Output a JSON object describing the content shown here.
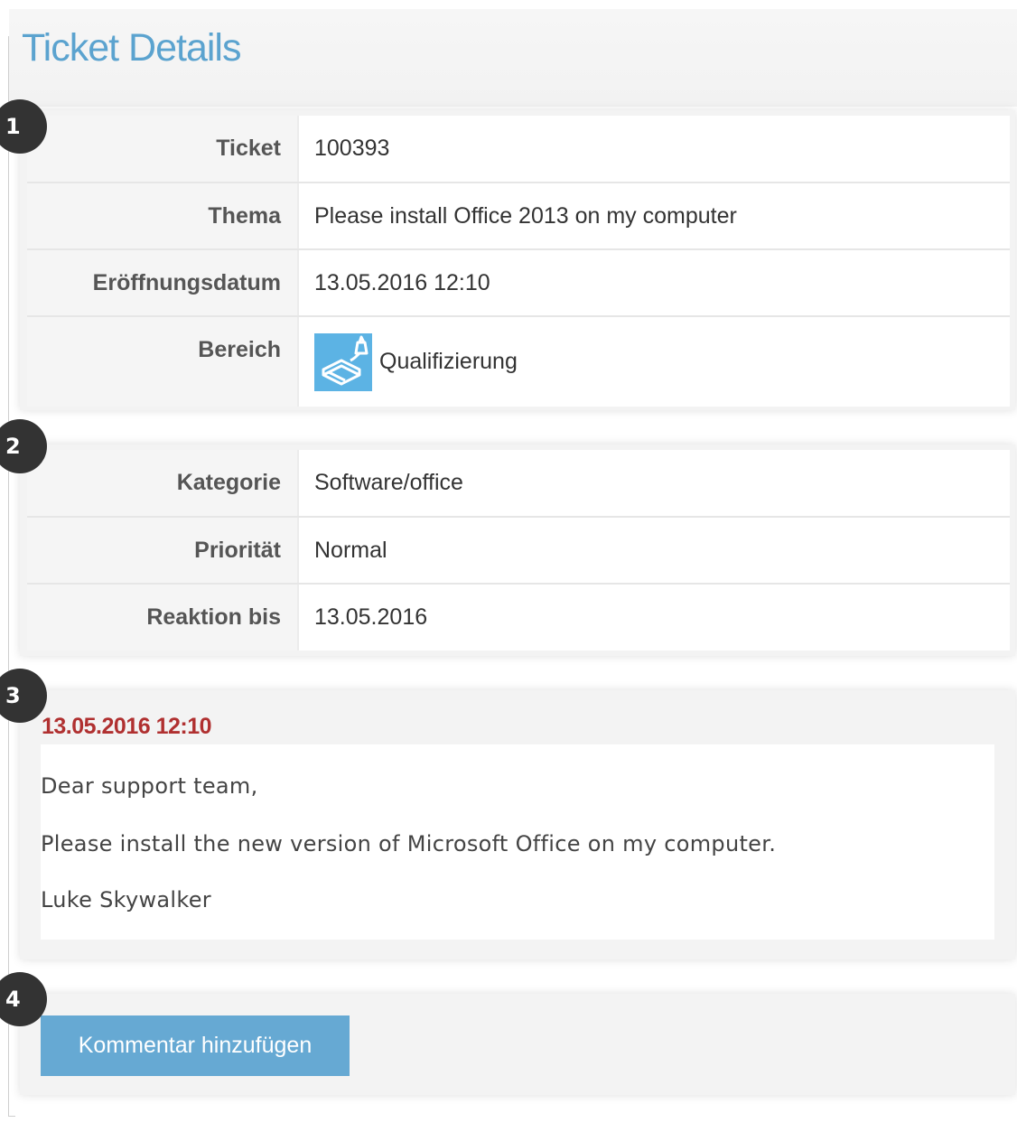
{
  "page": {
    "title": "Ticket Details"
  },
  "badges": [
    "1",
    "2",
    "3",
    "4"
  ],
  "section1": {
    "rows": [
      {
        "label": "Ticket",
        "value": "100393"
      },
      {
        "label": "Thema",
        "value": "Please install Office 2013 on my computer"
      },
      {
        "label": "Eröffnungsdatum",
        "value": "13.05.2016 12:10"
      },
      {
        "label": "Bereich",
        "value": "Qualifizierung",
        "icon": "document-stack-icon",
        "icon_color": "#5cb3e4"
      }
    ]
  },
  "section2": {
    "rows": [
      {
        "label": "Kategorie",
        "value": "Software/office"
      },
      {
        "label": "Priorität",
        "value": "Normal"
      },
      {
        "label": "Reaktion bis",
        "value": "13.05.2016"
      }
    ]
  },
  "message": {
    "date": "13.05.2016 12:10",
    "lines": [
      "Dear support team,",
      "Please install the new version of Microsoft Office on my computer.",
      "Luke Skywalker"
    ]
  },
  "actions": {
    "add_comment_label": "Kommentar hinzufügen"
  },
  "colors": {
    "title": "#5ba3cf",
    "date_red": "#b03030",
    "button": "#66a9d3",
    "badge": "#333333"
  }
}
